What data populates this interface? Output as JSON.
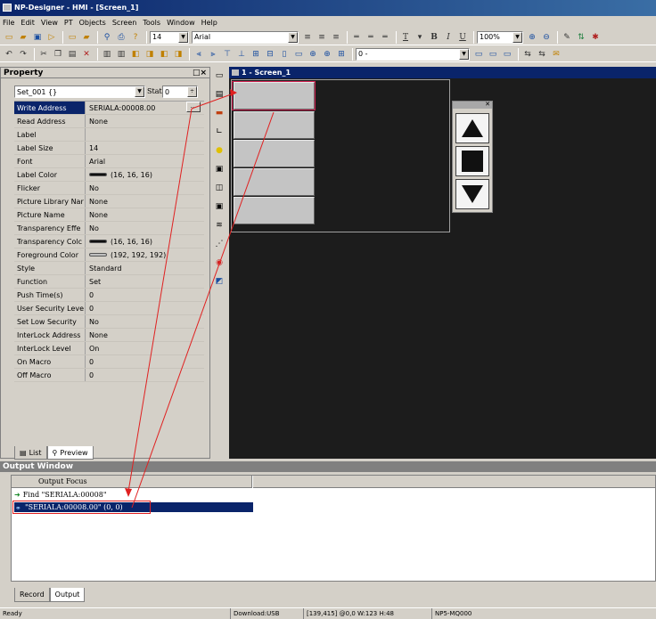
{
  "window": {
    "title": "NP-Designer - HMI - [Screen_1]"
  },
  "menu": [
    "File",
    "Edit",
    "View",
    "PT",
    "Objects",
    "Screen",
    "Tools",
    "Window",
    "Help"
  ],
  "toolbar": {
    "font_size": "14",
    "font_name": "Arial",
    "zoom": "100%",
    "state_combo": "0 -",
    "bold": "B",
    "italic": "I",
    "underline": "U",
    "text_tool": "T",
    "accent_color": "#0a246a"
  },
  "property_panel": {
    "title": "Property",
    "close": "□×",
    "object": "Set_001 {}",
    "state_label": "State",
    "state_value": "0",
    "rows": [
      {
        "name": "Write Address",
        "value": "SERIALA:00008.00",
        "selected": true
      },
      {
        "name": "Read Address",
        "value": "None"
      },
      {
        "name": "Label",
        "value": ""
      },
      {
        "name": "Label Size",
        "value": "14"
      },
      {
        "name": "Font",
        "value": "Arial"
      },
      {
        "name": "Label Color",
        "value": "(16, 16, 16)",
        "swatch": "#101010"
      },
      {
        "name": "Flicker",
        "value": "No"
      },
      {
        "name": "Picture Library Nar",
        "value": "None"
      },
      {
        "name": "Picture Name",
        "value": "None"
      },
      {
        "name": "Transparency Effe",
        "value": "No"
      },
      {
        "name": "Transparency Colc",
        "value": "(16, 16, 16)",
        "swatch": "#101010"
      },
      {
        "name": "Foreground Color",
        "value": "(192, 192, 192)",
        "swatch": "#c0c0c0"
      },
      {
        "name": "Style",
        "value": "Standard"
      },
      {
        "name": "Function",
        "value": "Set"
      },
      {
        "name": "Push Time(s)",
        "value": "0"
      },
      {
        "name": "User Security Leve",
        "value": "0"
      },
      {
        "name": "Set Low Security",
        "value": "No"
      },
      {
        "name": "InterLock Address",
        "value": "None"
      },
      {
        "name": "InterLock Level",
        "value": "On"
      },
      {
        "name": "On Macro",
        "value": "0"
      },
      {
        "name": "Off Macro",
        "value": "0"
      }
    ],
    "tabs": [
      "List",
      "Preview"
    ]
  },
  "editor": {
    "tab": "1 - Screen_1"
  },
  "output": {
    "title": "Output Window",
    "column": "Output Focus",
    "find_line": "Find \"SERIALA:00008\"",
    "result_line": "\"SERIALA:00008.00\" (0, 0)",
    "tabs": [
      "Record",
      "Output"
    ]
  },
  "status": {
    "ready": "Ready",
    "download": "Download:USB",
    "coords": "[139,415] @0,0 W:123 H:48",
    "model": "NP5-MQ000"
  },
  "annotation_color": "#e02020"
}
